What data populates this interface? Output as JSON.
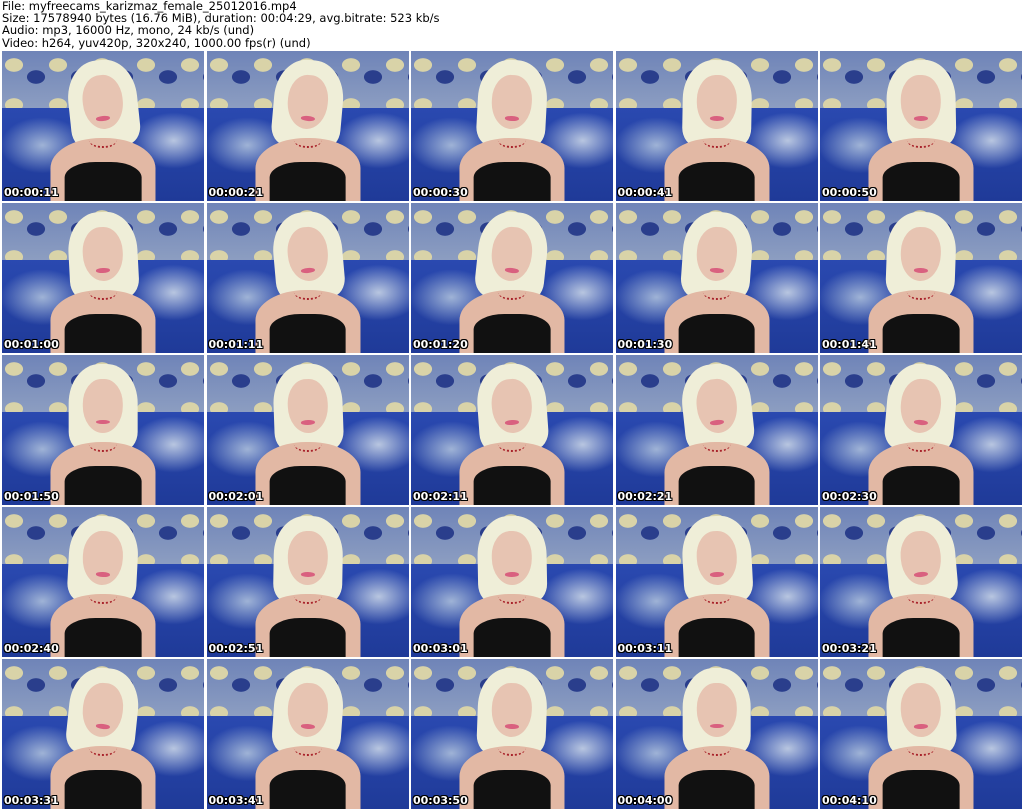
{
  "header": {
    "file_label": "File:",
    "file_value": "myfreecams_karizmaz_female_25012016.mp4",
    "size_label": "Size:",
    "size_value": "17578940 bytes (16.76 MiB), duration: 00:04:29, avg.bitrate: 523 kb/s",
    "audio_label": "Audio:",
    "audio_value": "mp3, 16000 Hz, mono, 24 kb/s (und)",
    "video_label": "Video:",
    "video_value": "h264, yuv420p, 320x240, 1000.00 fps(r) (und)"
  },
  "thumbnails": [
    {
      "timestamp": "00:00:11"
    },
    {
      "timestamp": "00:00:21"
    },
    {
      "timestamp": "00:00:30"
    },
    {
      "timestamp": "00:00:41"
    },
    {
      "timestamp": "00:00:50"
    },
    {
      "timestamp": "00:01:00"
    },
    {
      "timestamp": "00:01:11"
    },
    {
      "timestamp": "00:01:20"
    },
    {
      "timestamp": "00:01:30"
    },
    {
      "timestamp": "00:01:41"
    },
    {
      "timestamp": "00:01:50"
    },
    {
      "timestamp": "00:02:01"
    },
    {
      "timestamp": "00:02:11"
    },
    {
      "timestamp": "00:02:21"
    },
    {
      "timestamp": "00:02:30"
    },
    {
      "timestamp": "00:02:40"
    },
    {
      "timestamp": "00:02:51"
    },
    {
      "timestamp": "00:03:01"
    },
    {
      "timestamp": "00:03:11"
    },
    {
      "timestamp": "00:03:21"
    },
    {
      "timestamp": "00:03:31"
    },
    {
      "timestamp": "00:03:41"
    },
    {
      "timestamp": "00:03:50"
    },
    {
      "timestamp": "00:04:00"
    },
    {
      "timestamp": "00:04:10"
    }
  ],
  "colors": {
    "background": "#ffffff",
    "header_text": "#000000",
    "timestamp_text": "#ffffff",
    "timestamp_outline": "#000000"
  }
}
